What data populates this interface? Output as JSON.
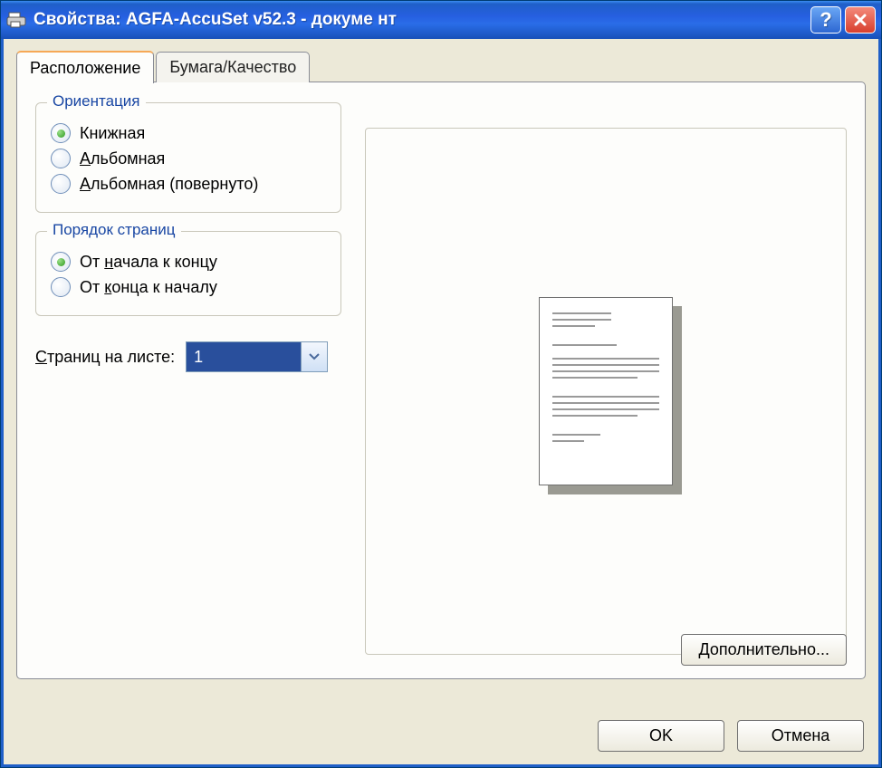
{
  "window": {
    "title": "Свойства: AGFA-AccuSet v52.3 - докуме нт"
  },
  "tabs": {
    "layout": "Расположение",
    "paper": "Бумага/Качество"
  },
  "orientation": {
    "legend": "Ориентация",
    "portrait": "Книжная",
    "landscape_prefix": "А",
    "landscape_rest": "льбомная",
    "landscape_rot_prefix": "А",
    "landscape_rot_rest": "льбомная (повернуто)"
  },
  "page_order": {
    "legend": "Порядок страниц",
    "front_to_back_pre": "От ",
    "front_to_back_u": "н",
    "front_to_back_post": "ачала к концу",
    "back_to_front_pre": "От ",
    "back_to_front_u": "к",
    "back_to_front_post": "онца к началу"
  },
  "pages_per_sheet": {
    "label_u": "С",
    "label_rest": "траниц на листе:",
    "value": "1"
  },
  "buttons": {
    "advanced": "Дополнительно...",
    "ok": "OK",
    "cancel": "Отмена"
  }
}
